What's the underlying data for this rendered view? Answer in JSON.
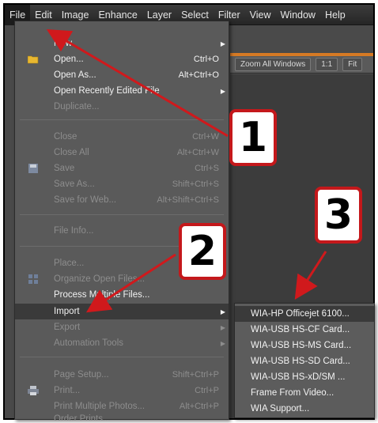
{
  "menubar": {
    "items": [
      "File",
      "Edit",
      "Image",
      "Enhance",
      "Layer",
      "Select",
      "Filter",
      "View",
      "Window",
      "Help"
    ]
  },
  "options_bar": {
    "zoom_all_windows": "Zoom All Windows",
    "one_to_one": "1:1",
    "fit": "Fit"
  },
  "file_menu": {
    "new": "New",
    "open": "Open...",
    "open_sc": "Ctrl+O",
    "open_as": "Open As...",
    "open_as_sc": "Alt+Ctrl+O",
    "open_recent": "Open Recently Edited File",
    "duplicate": "Duplicate...",
    "close": "Close",
    "close_sc": "Ctrl+W",
    "close_all": "Close All",
    "close_all_sc": "Alt+Ctrl+W",
    "save": "Save",
    "save_sc": "Ctrl+S",
    "save_as": "Save As...",
    "save_as_sc": "Shift+Ctrl+S",
    "save_web": "Save for Web...",
    "save_web_sc": "Alt+Shift+Ctrl+S",
    "file_info": "File Info...",
    "place": "Place...",
    "organize": "Organize Open Files...",
    "process_multiple": "Process Multiple Files...",
    "import": "Import",
    "export": "Export",
    "automation": "Automation Tools",
    "page_setup": "Page Setup...",
    "page_setup_sc": "Shift+Ctrl+P",
    "print": "Print...",
    "print_sc": "Ctrl+P",
    "print_multiple": "Print Multiple Photos...",
    "print_multiple_sc": "Alt+Ctrl+P",
    "order_prints": "Order Prints..."
  },
  "import_submenu": {
    "items": [
      "WIA-HP Officejet 6100...",
      "WIA-USB   HS-CF Card...",
      "WIA-USB   HS-MS Card...",
      "WIA-USB   HS-SD Card...",
      "WIA-USB   HS-xD/SM ...",
      "Frame From Video...",
      "WIA Support..."
    ]
  },
  "callouts": [
    "1",
    "2",
    "3"
  ],
  "colors": {
    "accent_orange": "#d67a24",
    "callout_red": "#c4181b",
    "menu_bg": "#5a5a5a",
    "menubar_bg": "#2e2e2e"
  }
}
